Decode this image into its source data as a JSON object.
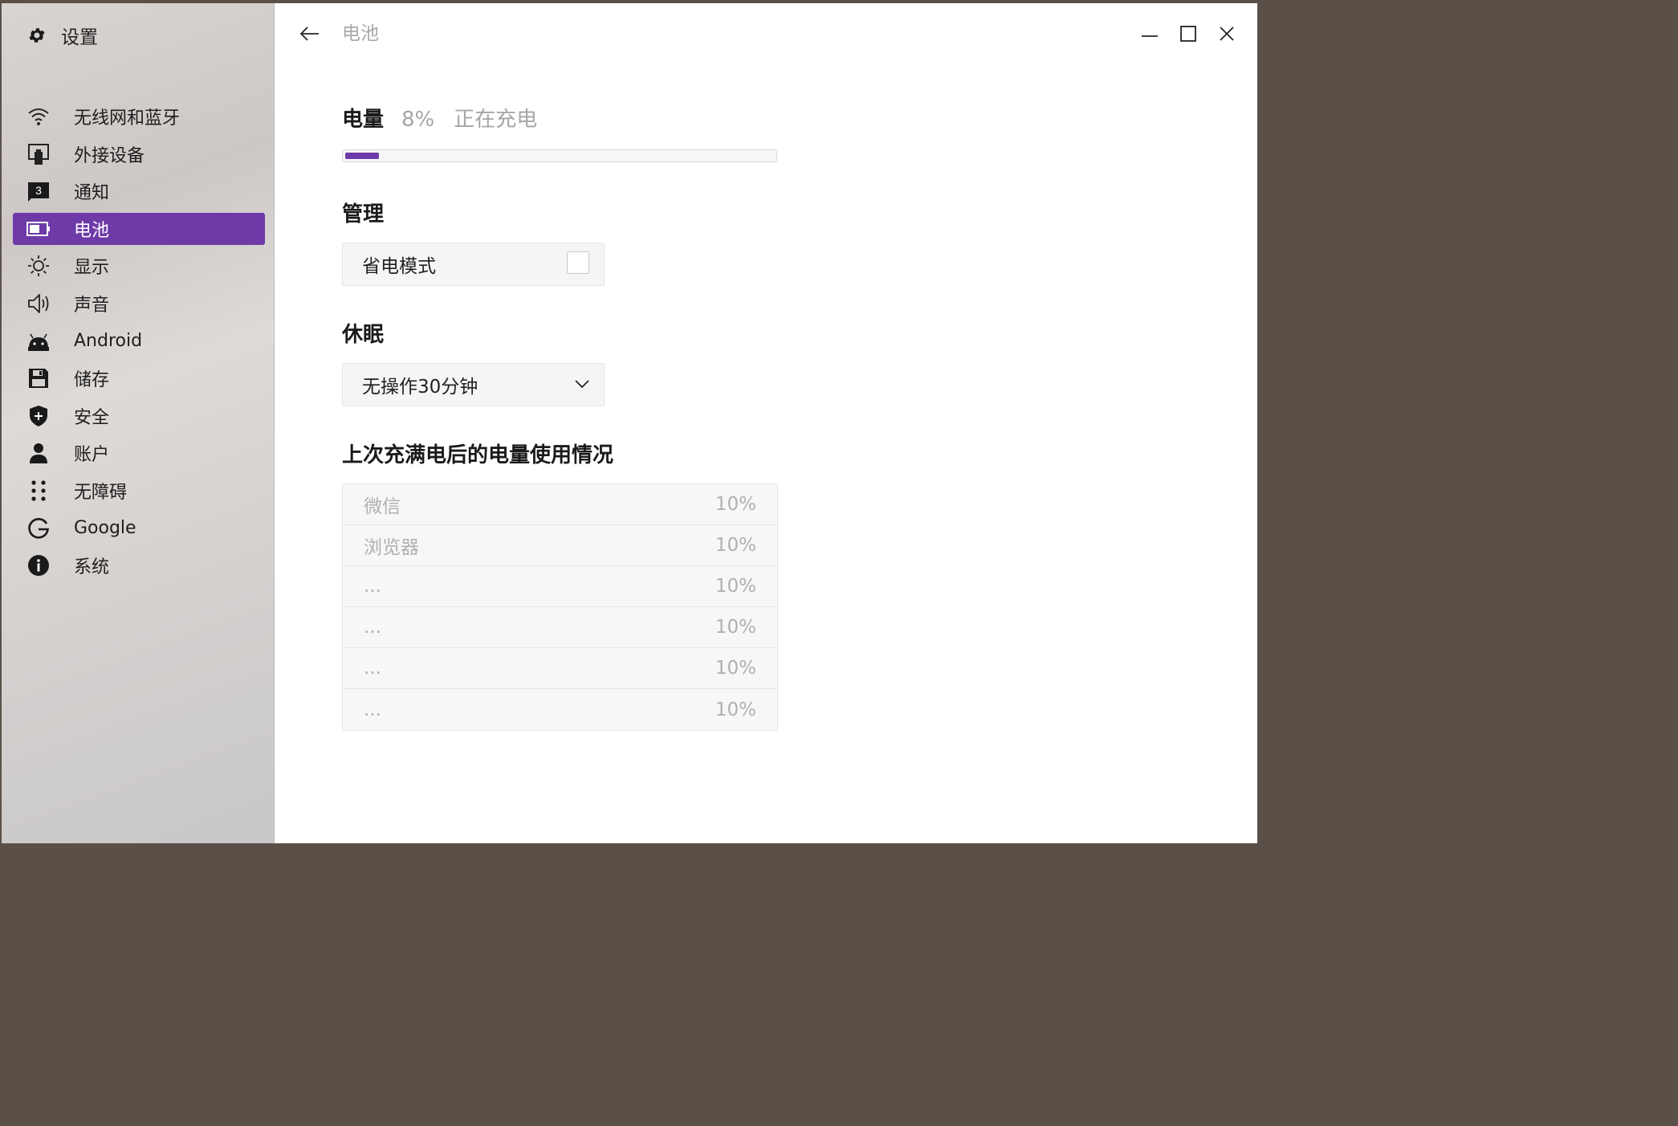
{
  "app": {
    "title": "设置"
  },
  "sidebar": {
    "items": [
      {
        "label": "无线网和蓝牙",
        "icon": "wifi-icon"
      },
      {
        "label": "外接设备",
        "icon": "external-device-icon"
      },
      {
        "label": "通知",
        "icon": "notification-icon",
        "badge": "3"
      },
      {
        "label": "电池",
        "icon": "battery-icon",
        "active": true
      },
      {
        "label": "显示",
        "icon": "brightness-icon"
      },
      {
        "label": "声音",
        "icon": "speaker-icon"
      },
      {
        "label": "Android",
        "icon": "android-icon"
      },
      {
        "label": "储存",
        "icon": "save-icon"
      },
      {
        "label": "安全",
        "icon": "shield-icon"
      },
      {
        "label": "账户",
        "icon": "user-icon"
      },
      {
        "label": "无障碍",
        "icon": "accessibility-icon"
      },
      {
        "label": "Google",
        "icon": "google-icon"
      },
      {
        "label": "系统",
        "icon": "info-icon"
      }
    ]
  },
  "header": {
    "title": "电池"
  },
  "battery": {
    "label": "电量",
    "percent_text": "8%",
    "level": 0.08,
    "status": "正在充电"
  },
  "manage": {
    "title": "管理",
    "power_saving_label": "省电模式",
    "power_saving_checked": false
  },
  "sleep": {
    "title": "休眠",
    "selected": "无操作30分钟"
  },
  "usage": {
    "title": "上次充满电后的电量使用情况",
    "rows": [
      {
        "name": "微信",
        "value": "10%"
      },
      {
        "name": "浏览器",
        "value": "10%"
      },
      {
        "name": "...",
        "value": "10%"
      },
      {
        "name": "...",
        "value": "10%"
      },
      {
        "name": "...",
        "value": "10%"
      },
      {
        "name": "...",
        "value": "10%"
      }
    ]
  },
  "colors": {
    "accent": "#6e3aa8"
  }
}
